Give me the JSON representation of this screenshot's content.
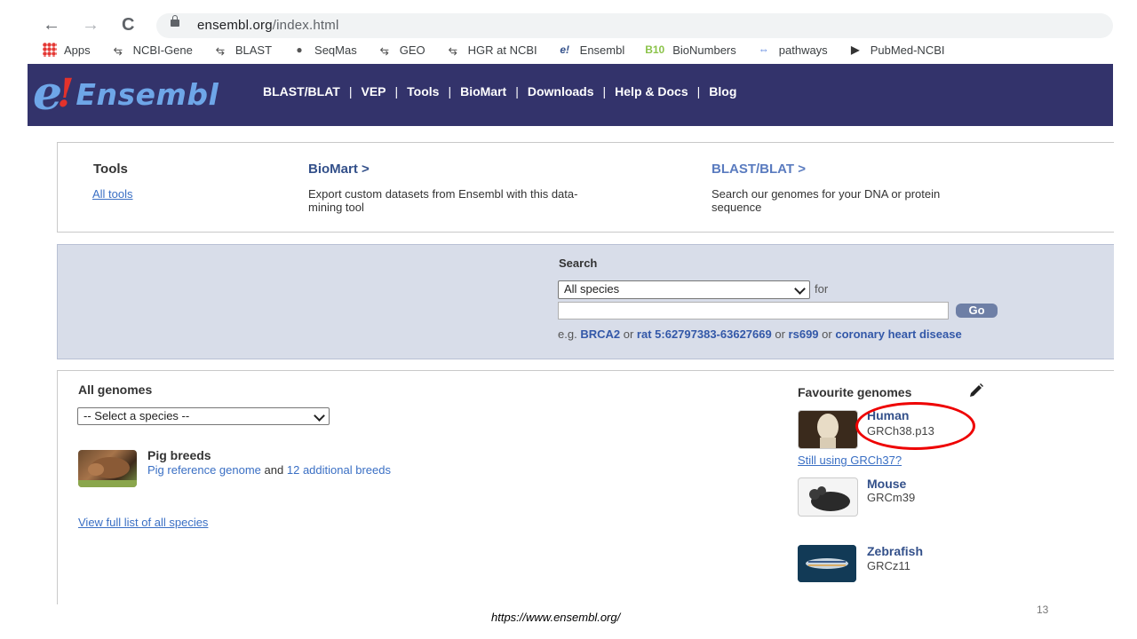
{
  "browser": {
    "back": "←",
    "forward": "→",
    "reload": "C",
    "url_host": "ensembl.org",
    "url_path": "/index.html",
    "bookmarks": [
      {
        "label": "Apps",
        "icon": "apps-grid-icon",
        "glyph": ""
      },
      {
        "label": "NCBI-Gene",
        "icon": "ncbi-icon",
        "glyph": "⥃"
      },
      {
        "label": "BLAST",
        "icon": "ncbi-icon",
        "glyph": "⥃"
      },
      {
        "label": "SeqMas",
        "icon": "globe-icon",
        "glyph": "●"
      },
      {
        "label": "GEO",
        "icon": "ncbi-icon",
        "glyph": "⥃"
      },
      {
        "label": "HGR at NCBI",
        "icon": "ncbi-icon",
        "glyph": "⥃"
      },
      {
        "label": "Ensembl",
        "icon": "ensembl-icon",
        "glyph": "e!"
      },
      {
        "label": "BioNumbers",
        "icon": "bionumbers-icon",
        "glyph": "B10"
      },
      {
        "label": "pathways",
        "icon": "link-icon",
        "glyph": "⇔"
      },
      {
        "label": "PubMed-NCBI",
        "icon": "pubmed-icon",
        "glyph": "▶"
      }
    ]
  },
  "header": {
    "logo_e": "e",
    "logo_bang": "!",
    "logo_name": "Ensembl",
    "nav": [
      "BLAST/BLAT",
      "VEP",
      "Tools",
      "BioMart",
      "Downloads",
      "Help & Docs",
      "Blog"
    ],
    "separator": "|"
  },
  "tools": {
    "title": "Tools",
    "all_tools": "All tools",
    "biomart_title": "BioMart >",
    "biomart_desc_1": "Export custom datasets from Ensembl with this data-",
    "biomart_desc_2": "mining tool",
    "blast_title": "BLAST/BLAT >",
    "blast_desc_1": "Search our genomes for your DNA or protein",
    "blast_desc_2": "sequence"
  },
  "search": {
    "title": "Search",
    "species_value": "All species",
    "for_label": "for",
    "query_value": "",
    "go_label": "Go",
    "eg_prefix": "e.g.",
    "examples": [
      "BRCA2",
      "rat 5:62797383-63627669",
      "rs699",
      "coronary heart disease"
    ],
    "eg_or": "or"
  },
  "genomes": {
    "all_title": "All genomes",
    "select_value": "-- Select a species --",
    "pig_title": "Pig breeds",
    "pig_link1": "Pig reference genome",
    "pig_and": "and",
    "pig_link2": "12 additional breeds",
    "view_full": "View full list of all species",
    "fav_title": "Favourite genomes",
    "favourites": [
      {
        "name": "Human",
        "assembly": "GRCh38.p13"
      },
      {
        "name": "Mouse",
        "assembly": "GRCm39"
      },
      {
        "name": "Zebrafish",
        "assembly": "GRCz11"
      }
    ],
    "still_using": "Still using GRCh37?"
  },
  "slide": {
    "footer_url": "https://www.ensembl.org/",
    "page_number": "13"
  },
  "colors": {
    "header_bg": "#33336b",
    "search_bg": "#d8dde9",
    "link": "#3a6fc4",
    "highlight_ellipse": "#e00000"
  }
}
